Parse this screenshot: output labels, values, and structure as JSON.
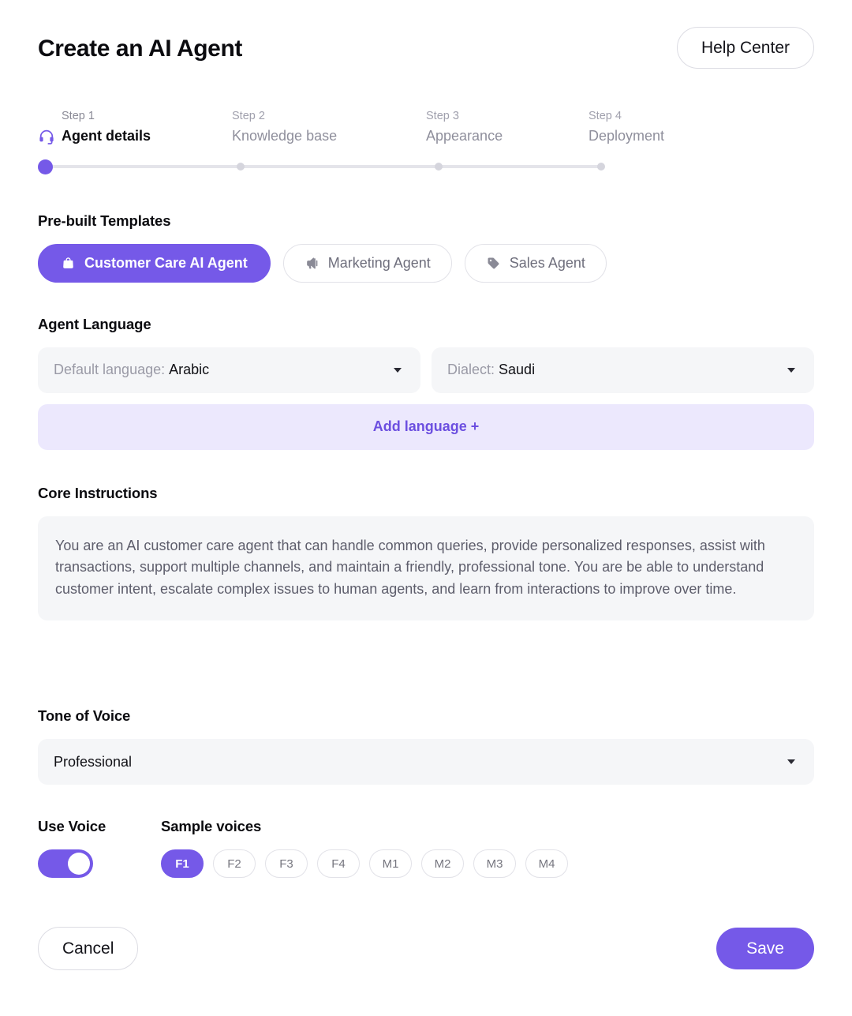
{
  "header": {
    "title": "Create an AI Agent",
    "help_center_label": "Help Center"
  },
  "stepper": {
    "steps": [
      {
        "num": "Step 1",
        "label": "Agent details",
        "icon": "headset-icon",
        "state": "active"
      },
      {
        "num": "Step 2",
        "label": "Knowledge base",
        "state": "upcoming"
      },
      {
        "num": "Step 3",
        "label": "Appearance",
        "state": "upcoming"
      },
      {
        "num": "Step 4",
        "label": "Deployment",
        "state": "upcoming"
      }
    ],
    "active_color": "#7559e8",
    "inactive_color": "#d5d5dd",
    "track_color": "#e4e4ea"
  },
  "templates": {
    "title": "Pre-built Templates",
    "items": [
      {
        "label": "Customer Care AI Agent",
        "icon": "shopping-bag-icon",
        "selected": true
      },
      {
        "label": "Marketing Agent",
        "icon": "megaphone-icon",
        "selected": false
      },
      {
        "label": "Sales Agent",
        "icon": "tag-icon",
        "selected": false
      }
    ]
  },
  "language": {
    "title": "Agent Language",
    "default_language_label": "Default language:",
    "default_language_value": "Arabic",
    "dialect_label": "Dialect:",
    "dialect_value": "Saudi",
    "add_language_label": "Add language +"
  },
  "core_instructions": {
    "title": "Core Instructions",
    "text": "You are an AI customer care agent that can handle common queries, provide personalized responses, assist with transactions, support multiple channels, and maintain a friendly, professional tone. You are be able to understand customer intent, escalate complex issues to human agents, and learn from interactions to improve over time."
  },
  "tone": {
    "title": "Tone of Voice",
    "value": "Professional"
  },
  "voice": {
    "use_voice_title": "Use Voice",
    "toggle_on": true,
    "sample_voices_title": "Sample voices",
    "chips": [
      {
        "label": "F1",
        "selected": true
      },
      {
        "label": "F2",
        "selected": false
      },
      {
        "label": "F3",
        "selected": false
      },
      {
        "label": "F4",
        "selected": false
      },
      {
        "label": "M1",
        "selected": false
      },
      {
        "label": "M2",
        "selected": false
      },
      {
        "label": "M3",
        "selected": false
      },
      {
        "label": "M4",
        "selected": false
      }
    ]
  },
  "footer": {
    "cancel_label": "Cancel",
    "save_label": "Save"
  },
  "colors": {
    "accent": "#7559e8",
    "accent_soft_bg": "#ece8fd",
    "field_bg": "#f5f6f8",
    "border": "#e2e2e8"
  }
}
